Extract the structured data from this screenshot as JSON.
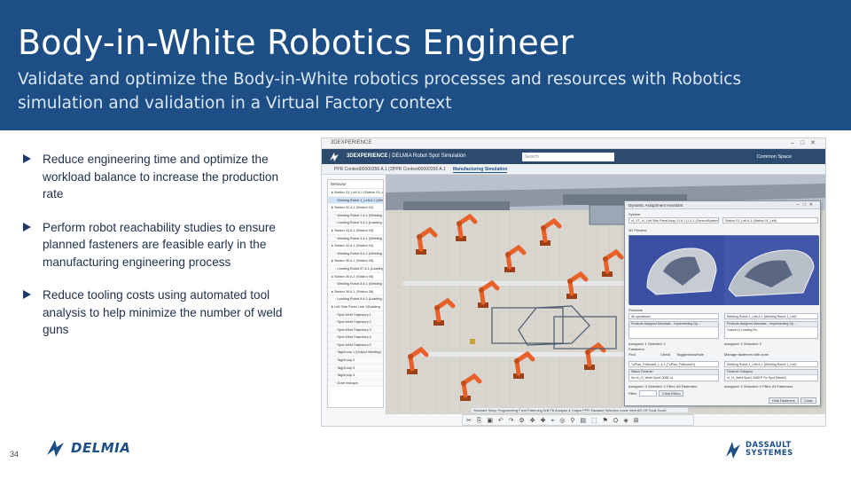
{
  "slide": {
    "title": "Body-in-White Robotics Engineer",
    "subtitle": "Validate and optimize the Body-in-White robotics processes and resources with Robotics simulation and validation in a Virtual Factory context",
    "bullets": [
      "Reduce engineering time and optimize the workload balance to increase the production rate",
      "Perform robot reachability studies to ensure planned fasteners are feasible early in the manufacturing engineering process",
      "Reduce tooling costs using automated tool analysis to help minimize the number of weld guns"
    ],
    "page_number": "34",
    "delmia_logo_text": "DELMIA",
    "ds_logo_line1": "DASSAULT",
    "ds_logo_line2": "SYSTEMES"
  },
  "colors": {
    "header_bg": "#1d4f86",
    "robot_orange": "#e8612a",
    "dialog_preview": "#3a4fa8"
  },
  "app": {
    "window_title": "3DEXPERIENCE",
    "brand_bold": "3DEXPERIENCE",
    "brand_rest": " | DELMIA  Robot Spot Simulation",
    "search_placeholder": "Search",
    "space_label": "Common Space",
    "tabs": [
      "PPR Context00000356 A.1 (2)",
      "PPR Context00000356 A.1",
      "Manufacturing Simulation"
    ],
    "tree_header": "Behavior",
    "tree_rows": [
      {
        "label": "Station 01_Left A.1 (Station 01_Left)",
        "type": "station"
      },
      {
        "label": "Welding Robot 1_Left A.1 (Welding Robot 1)",
        "type": "sub-sel"
      },
      {
        "label": "Station 02 A.1 (Station 02)",
        "type": "station"
      },
      {
        "label": "Welding Robot 2 A.1 (Welding Robot 2)",
        "type": "sub"
      },
      {
        "label": "Loading Robot 3 A.1 (Loading Robot 3)",
        "type": "sub"
      },
      {
        "label": "Station 03 A.1 (Station 03)",
        "type": "station"
      },
      {
        "label": "Welding Robot 4 A.1 (Welding Robot 4)",
        "type": "sub"
      },
      {
        "label": "Station 04 A.1 (Station 04)",
        "type": "station"
      },
      {
        "label": "Welding Robot 5 A.1 (Welding Robot 5)",
        "type": "sub"
      },
      {
        "label": "Station 05 A.1 (Station 05)",
        "type": "station"
      },
      {
        "label": "Loading Robot 07 A.1 (Loading Robot 07)",
        "type": "sub"
      },
      {
        "label": "Station 06 A.1 (Station 06)",
        "type": "station"
      },
      {
        "label": "Welding Robot 8 A.1 (Welding Robot 8)",
        "type": "sub"
      },
      {
        "label": "Station 08 A.1 (Station 08)",
        "type": "station"
      },
      {
        "label": "Loading Robot 9 A.1 (Loading Robot 9)",
        "type": "sub"
      },
      {
        "label": "Left Side Panel Line 1/Building",
        "type": "station"
      },
      {
        "label": "Spot Weld Trajectory 1",
        "type": "sub"
      },
      {
        "label": "Spot Weld Trajectory 2",
        "type": "sub"
      },
      {
        "label": "Spot Weld Trajectory 3",
        "type": "sub"
      },
      {
        "label": "Spot Weld Trajectory 4",
        "type": "sub"
      },
      {
        "label": "Spot Weld Trajectory 5",
        "type": "sub"
      },
      {
        "label": "TagGroup 1 (Output Welding)",
        "type": "sub"
      },
      {
        "label": "TagGroup 2",
        "type": "sub"
      },
      {
        "label": "TagGroup 3",
        "type": "sub"
      },
      {
        "label": "TagGroup 4",
        "type": "sub"
      },
      {
        "label": "Zone reshape",
        "type": "sub"
      }
    ],
    "dialog": {
      "title": "Dynamic Assignment Assistant",
      "system_label": "System",
      "system_value": "r4_VT_r4_Left Side Panel Assy 13 A.1 (1 A.1 (GeneralSystem))",
      "station_value": "Station 01_Left A.1 (Station 01_Left)",
      "preview_label": "3D Preview",
      "products_label": "Products",
      "all_operations": "All operations",
      "robot_label": "Welding Robot 1_Left A.1 (Welding Robot 1_Left)",
      "col_products": "Products",
      "col_assigned": "Assigned Manufact...",
      "col_implementing": "Implementing Op...",
      "col_products2": "Products",
      "col_assigned2": "Assigned Manufact...",
      "col_implementing2": "Implementing Op...",
      "output_value": "Output (r) Loading Ro...",
      "assigned_row": "Assigned: 1     Selected: 1",
      "assigned_row2": "Assigned: 0     Selected: 0",
      "fasteners_label": "Fasteners",
      "find_label": "Find",
      "check_label": "Check",
      "toggle_label": "Toggle/show/hide",
      "manage_label": "Manage fasteners with zone",
      "fastener_value": "TuPlan_FeBucket_L A.1 (TuPlan_FeBucket1)",
      "robot_value2": "Welding Robot 1_Left A.1 (Welding Robot 1_Left)",
      "fast_col1": "Status",
      "fast_col2": "Fastener",
      "fast_col3": "Category",
      "fast_row1": "No     r4_r3_Weld Spot1 0085.14",
      "fast_row2": "r4_r3_Weld Spot1 0085.P      Fix Spot (Weld2)",
      "assigned_row3": "Assigned: 0     Selected: 1     Filter: All Fasteners",
      "assigned_row4": "Assigned: 0     Selected: 0     Filter: All Fasteners",
      "filter_label": "Filter:",
      "clear_filters": "Clear Filters",
      "hide_fasteners": "Hide Fasteners",
      "close": "Close"
    },
    "bottom_tabs": "Standard  Setup  Programming  Point Fastening  Drill Fill  Analysis & Output  PPR Standard  Selection mode  View  AR-VR  Tools  Touch"
  }
}
